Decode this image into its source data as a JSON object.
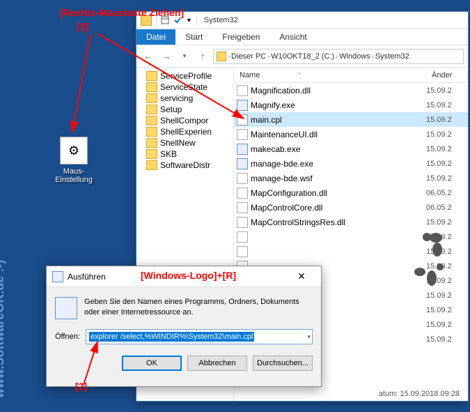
{
  "watermark": "www.SoftwareOK.de :-)",
  "desktop_icon": {
    "label": "Maus-Einstellung"
  },
  "explorer": {
    "qat_title": "System32",
    "menu": {
      "file": "Datei",
      "start": "Start",
      "share": "Freigeben",
      "view": "Ansicht"
    },
    "breadcrumb": [
      "Dieser PC",
      "W10OKT18_2 (C:)",
      "Windows",
      "System32"
    ],
    "nav_folders": [
      "ServiceProfile",
      "ServiceState",
      "servicing",
      "Setup",
      "ShellCompor",
      "ShellExperien",
      "ShellNew",
      "SKB",
      "SoftwareDistr"
    ],
    "columns": {
      "name": "Name",
      "date": "Änder"
    },
    "files": [
      {
        "name": "Magnification.dll",
        "type": "dll",
        "date": "15.09.2"
      },
      {
        "name": "Magnify.exe",
        "type": "exe",
        "date": "15.09.2"
      },
      {
        "name": "main.cpl",
        "type": "cpl",
        "date": "15.09.2",
        "selected": true
      },
      {
        "name": "MaintenanceUI.dll",
        "type": "dll",
        "date": "15.09.2"
      },
      {
        "name": "makecab.exe",
        "type": "exe",
        "date": "15.09.2"
      },
      {
        "name": "manage-bde.exe",
        "type": "exe",
        "date": "15.09.2"
      },
      {
        "name": "manage-bde.wsf",
        "type": "dll",
        "date": "15.09.2"
      },
      {
        "name": "MapConfiguration.dll",
        "type": "dll",
        "date": "06.05.2"
      },
      {
        "name": "MapControlCore.dll",
        "type": "dll",
        "date": "06.05.2"
      },
      {
        "name": "MapControlStringsRes.dll",
        "type": "dll",
        "date": "15.09.2"
      },
      {
        "name": "",
        "type": "dll",
        "date": "15.09.2"
      },
      {
        "name": "",
        "type": "dll",
        "date": "15.09.2"
      },
      {
        "name": "",
        "type": "dll",
        "date": "15.09.2"
      },
      {
        "name": "",
        "type": "dll",
        "date": "15.09.2"
      },
      {
        "name": "",
        "type": "dll",
        "date": "15.09.2"
      },
      {
        "name": "",
        "type": "dll",
        "date": "15.09.2"
      },
      {
        "name": "",
        "type": "dll",
        "date": "15.09.2"
      },
      {
        "name": "",
        "type": "dll",
        "date": "15.09.2"
      }
    ],
    "status": "atum: 15.09.2018 09:28"
  },
  "run": {
    "title": "Ausführen",
    "desc": "Geben Sie den Namen eines Programms, Ordners, Dokuments oder einer Internetressource an.",
    "open_label": "Öffnen:",
    "command": "explorer /select,%WINDIR%\\System32\\main.cpl",
    "ok": "OK",
    "cancel": "Abbrechen",
    "browse": "Durchsuchen..."
  },
  "annotations": {
    "drag": "[Rechts-Maustaste Ziehen]",
    "num3": "[3]",
    "winr": "[Windows-Logo]+[R]",
    "num2": "[2]"
  }
}
